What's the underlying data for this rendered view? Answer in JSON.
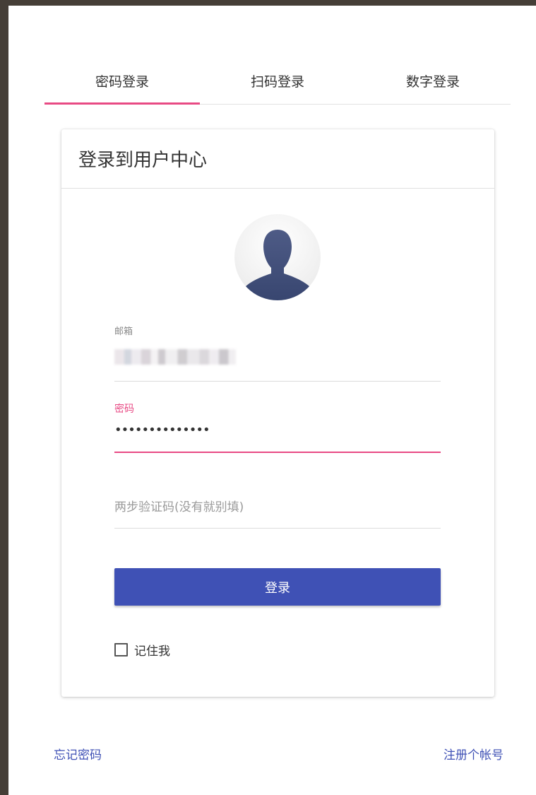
{
  "tabs": [
    {
      "label": "密码登录",
      "active": true
    },
    {
      "label": "扫码登录",
      "active": false
    },
    {
      "label": "数字登录",
      "active": false
    }
  ],
  "card": {
    "title": "登录到用户中心",
    "avatar_icon": "user-silhouette-icon",
    "email": {
      "label": "邮箱",
      "value": ""
    },
    "password": {
      "label": "密码",
      "value": "••••••••••••••"
    },
    "twofa": {
      "placeholder": "两步验证码(没有就别填)"
    },
    "login_button": "登录",
    "remember_label": "记住我"
  },
  "footer": {
    "forgot_password": "忘记密码",
    "register": "注册个帐号"
  },
  "colors": {
    "accent": "#e84a84",
    "primary": "#3f51b5",
    "background": "#453e37"
  }
}
